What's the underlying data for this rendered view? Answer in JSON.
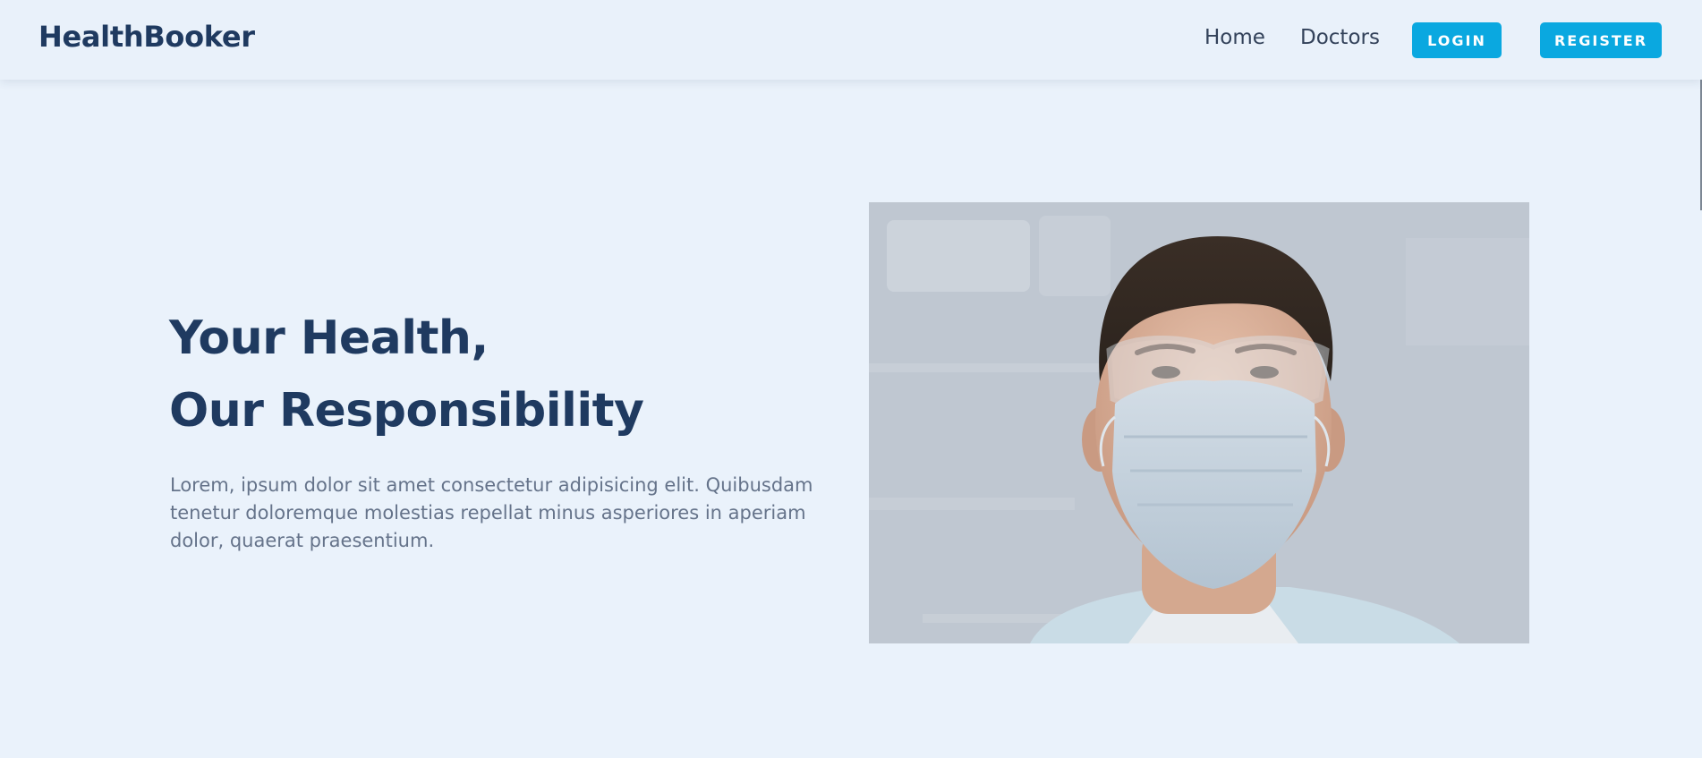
{
  "brand": "HealthBooker",
  "nav": {
    "home": "Home",
    "doctors": "Doctors",
    "login": "LOGIN",
    "register": "REGISTER"
  },
  "hero": {
    "title_line1": "Your Health,",
    "title_line2": "Our Responsibility",
    "description": "Lorem, ipsum dolor sit amet consectetur adipisicing elit. Quibusdam tenetur doloremque molestias repellat minus asperiores in aperiam dolor, quaerat praesentium.",
    "image_subject": "doctor-with-mask-and-goggles"
  },
  "colors": {
    "brand_navy": "#1f3a60",
    "accent_blue": "#0aa8e0",
    "page_background": "#eaf2fb",
    "body_text": "#65738a"
  }
}
